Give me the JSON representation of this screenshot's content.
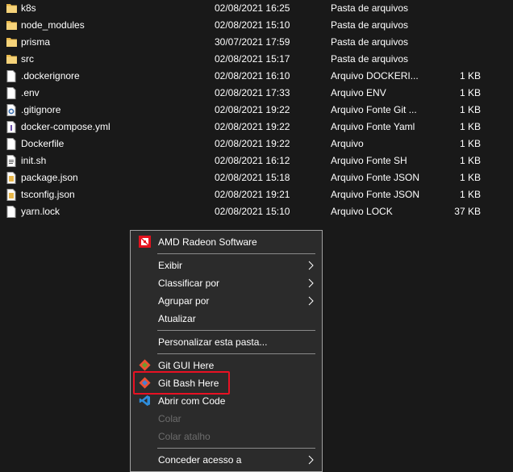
{
  "files": [
    {
      "name": "k8s",
      "date": "02/08/2021 16:25",
      "type": "Pasta de arquivos",
      "size": "",
      "icon": "folder-icon"
    },
    {
      "name": "node_modules",
      "date": "02/08/2021 15:10",
      "type": "Pasta de arquivos",
      "size": "",
      "icon": "folder-icon"
    },
    {
      "name": "prisma",
      "date": "30/07/2021 17:59",
      "type": "Pasta de arquivos",
      "size": "",
      "icon": "folder-icon"
    },
    {
      "name": "src",
      "date": "02/08/2021 15:17",
      "type": "Pasta de arquivos",
      "size": "",
      "icon": "folder-icon"
    },
    {
      "name": ".dockerignore",
      "date": "02/08/2021 16:10",
      "type": "Arquivo DOCKERI...",
      "size": "1 KB",
      "icon": "file-icon"
    },
    {
      "name": ".env",
      "date": "02/08/2021 17:33",
      "type": "Arquivo ENV",
      "size": "1 KB",
      "icon": "file-icon"
    },
    {
      "name": ".gitignore",
      "date": "02/08/2021 19:22",
      "type": "Arquivo Fonte Git ...",
      "size": "1 KB",
      "icon": "gear-file-icon"
    },
    {
      "name": "docker-compose.yml",
      "date": "02/08/2021 19:22",
      "type": "Arquivo Fonte Yaml",
      "size": "1 KB",
      "icon": "yaml-file-icon"
    },
    {
      "name": "Dockerfile",
      "date": "02/08/2021 19:22",
      "type": "Arquivo",
      "size": "1 KB",
      "icon": "file-icon"
    },
    {
      "name": "init.sh",
      "date": "02/08/2021 16:12",
      "type": "Arquivo Fonte SH",
      "size": "1 KB",
      "icon": "script-file-icon"
    },
    {
      "name": "package.json",
      "date": "02/08/2021 15:18",
      "type": "Arquivo Fonte JSON",
      "size": "1 KB",
      "icon": "json-file-icon"
    },
    {
      "name": "tsconfig.json",
      "date": "02/08/2021 19:21",
      "type": "Arquivo Fonte JSON",
      "size": "1 KB",
      "icon": "json-file-icon"
    },
    {
      "name": "yarn.lock",
      "date": "02/08/2021 15:10",
      "type": "Arquivo LOCK",
      "size": "37 KB",
      "icon": "file-icon"
    }
  ],
  "menu": {
    "amd": "AMD Radeon Software",
    "exibir": "Exibir",
    "classificar": "Classificar por",
    "agrupar": "Agrupar por",
    "atualizar": "Atualizar",
    "personalizar": "Personalizar esta pasta...",
    "git_gui": "Git GUI Here",
    "git_bash": "Git Bash Here",
    "vscode": "Abrir com Code",
    "colar": "Colar",
    "colar_atalho": "Colar atalho",
    "conceder": "Conceder acesso a"
  },
  "colors": {
    "background": "#191919",
    "menu_background": "#2b2b2b",
    "highlight": "#e81123",
    "folder": "#e8b74a",
    "amd": "#e3121e",
    "git": "#f05032",
    "vscode": "#2e8ddb"
  }
}
